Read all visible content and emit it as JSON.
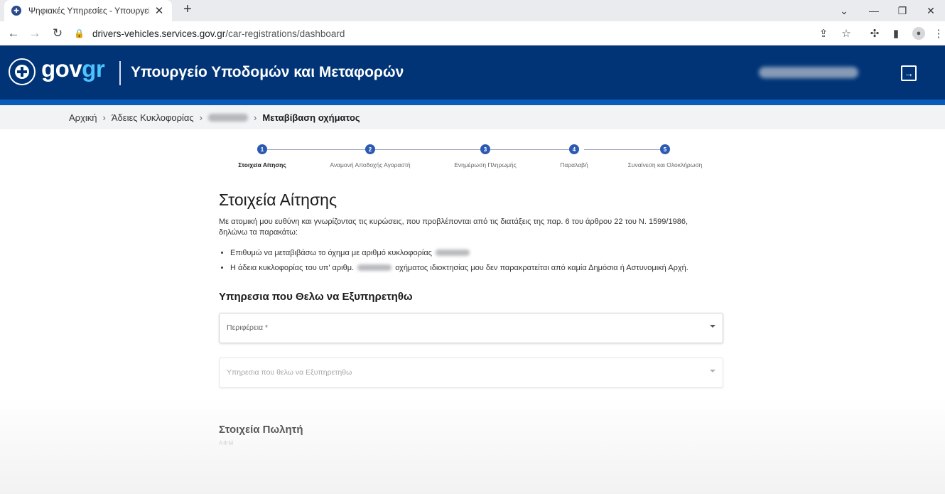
{
  "browser": {
    "tab_title": "Ψηφιακές Υπηρεσίες - Υπουργεί",
    "tab_close": "✕",
    "new_tab": "+",
    "url_host": "drivers-vehicles.services.gov.gr",
    "url_path": "/car-registrations/dashboard"
  },
  "header": {
    "brand_gov": "gov",
    "brand_gr": "gr",
    "ministry": "Υπουργείο Υποδομών και Μεταφορών"
  },
  "breadcrumb": {
    "items": [
      "Αρχική",
      "Άδειες Κυκλοφορίας"
    ],
    "current": "Μεταβίβαση οχήματος",
    "separator": "›"
  },
  "stepper": {
    "steps": [
      {
        "number": "1",
        "label": "Στοιχεία Αίτησης"
      },
      {
        "number": "2",
        "label": "Αναμονή Αποδοχής Αγοραστή"
      },
      {
        "number": "3",
        "label": "Ενημέρωση Πληρωμής"
      },
      {
        "number": "4",
        "label": "Παραλαβή"
      },
      {
        "number": "5",
        "label": "Συναίνεση και Ολοκλήρωση"
      }
    ]
  },
  "main": {
    "title": "Στοιχεία Αίτησης",
    "intro": "Με ατομική μου ευθύνη και γνωρίζοντας τις κυρώσεις, που προβλέπονται από τις διατάξεις της παρ. 6 του άρθρου 22 του Ν. 1599/1986, δηλώνω τα παρακάτω:",
    "bullet1": "Επιθυμώ να μεταβιβάσω το όχημα με αριθμό κυκλοφορίας",
    "bullet2_a": "Η άδεια κυκλοφορίας του υπ' αριθμ.",
    "bullet2_b": "οχήματος ιδιοκτησίας μου δεν παρακρατείται από καμία Δημόσια ή Αστυνομική Αρχή.",
    "service_heading": "Υπηρεσια που Θελω να Εξυπηρετηθω",
    "region_placeholder": "Περιφέρεια *",
    "service_placeholder": "Υπηρεσια που θελω να Εξυπηρετηθω",
    "seller_heading": "Στοιχεία Πωλητή",
    "afm_label": "ΑΦΜ"
  }
}
